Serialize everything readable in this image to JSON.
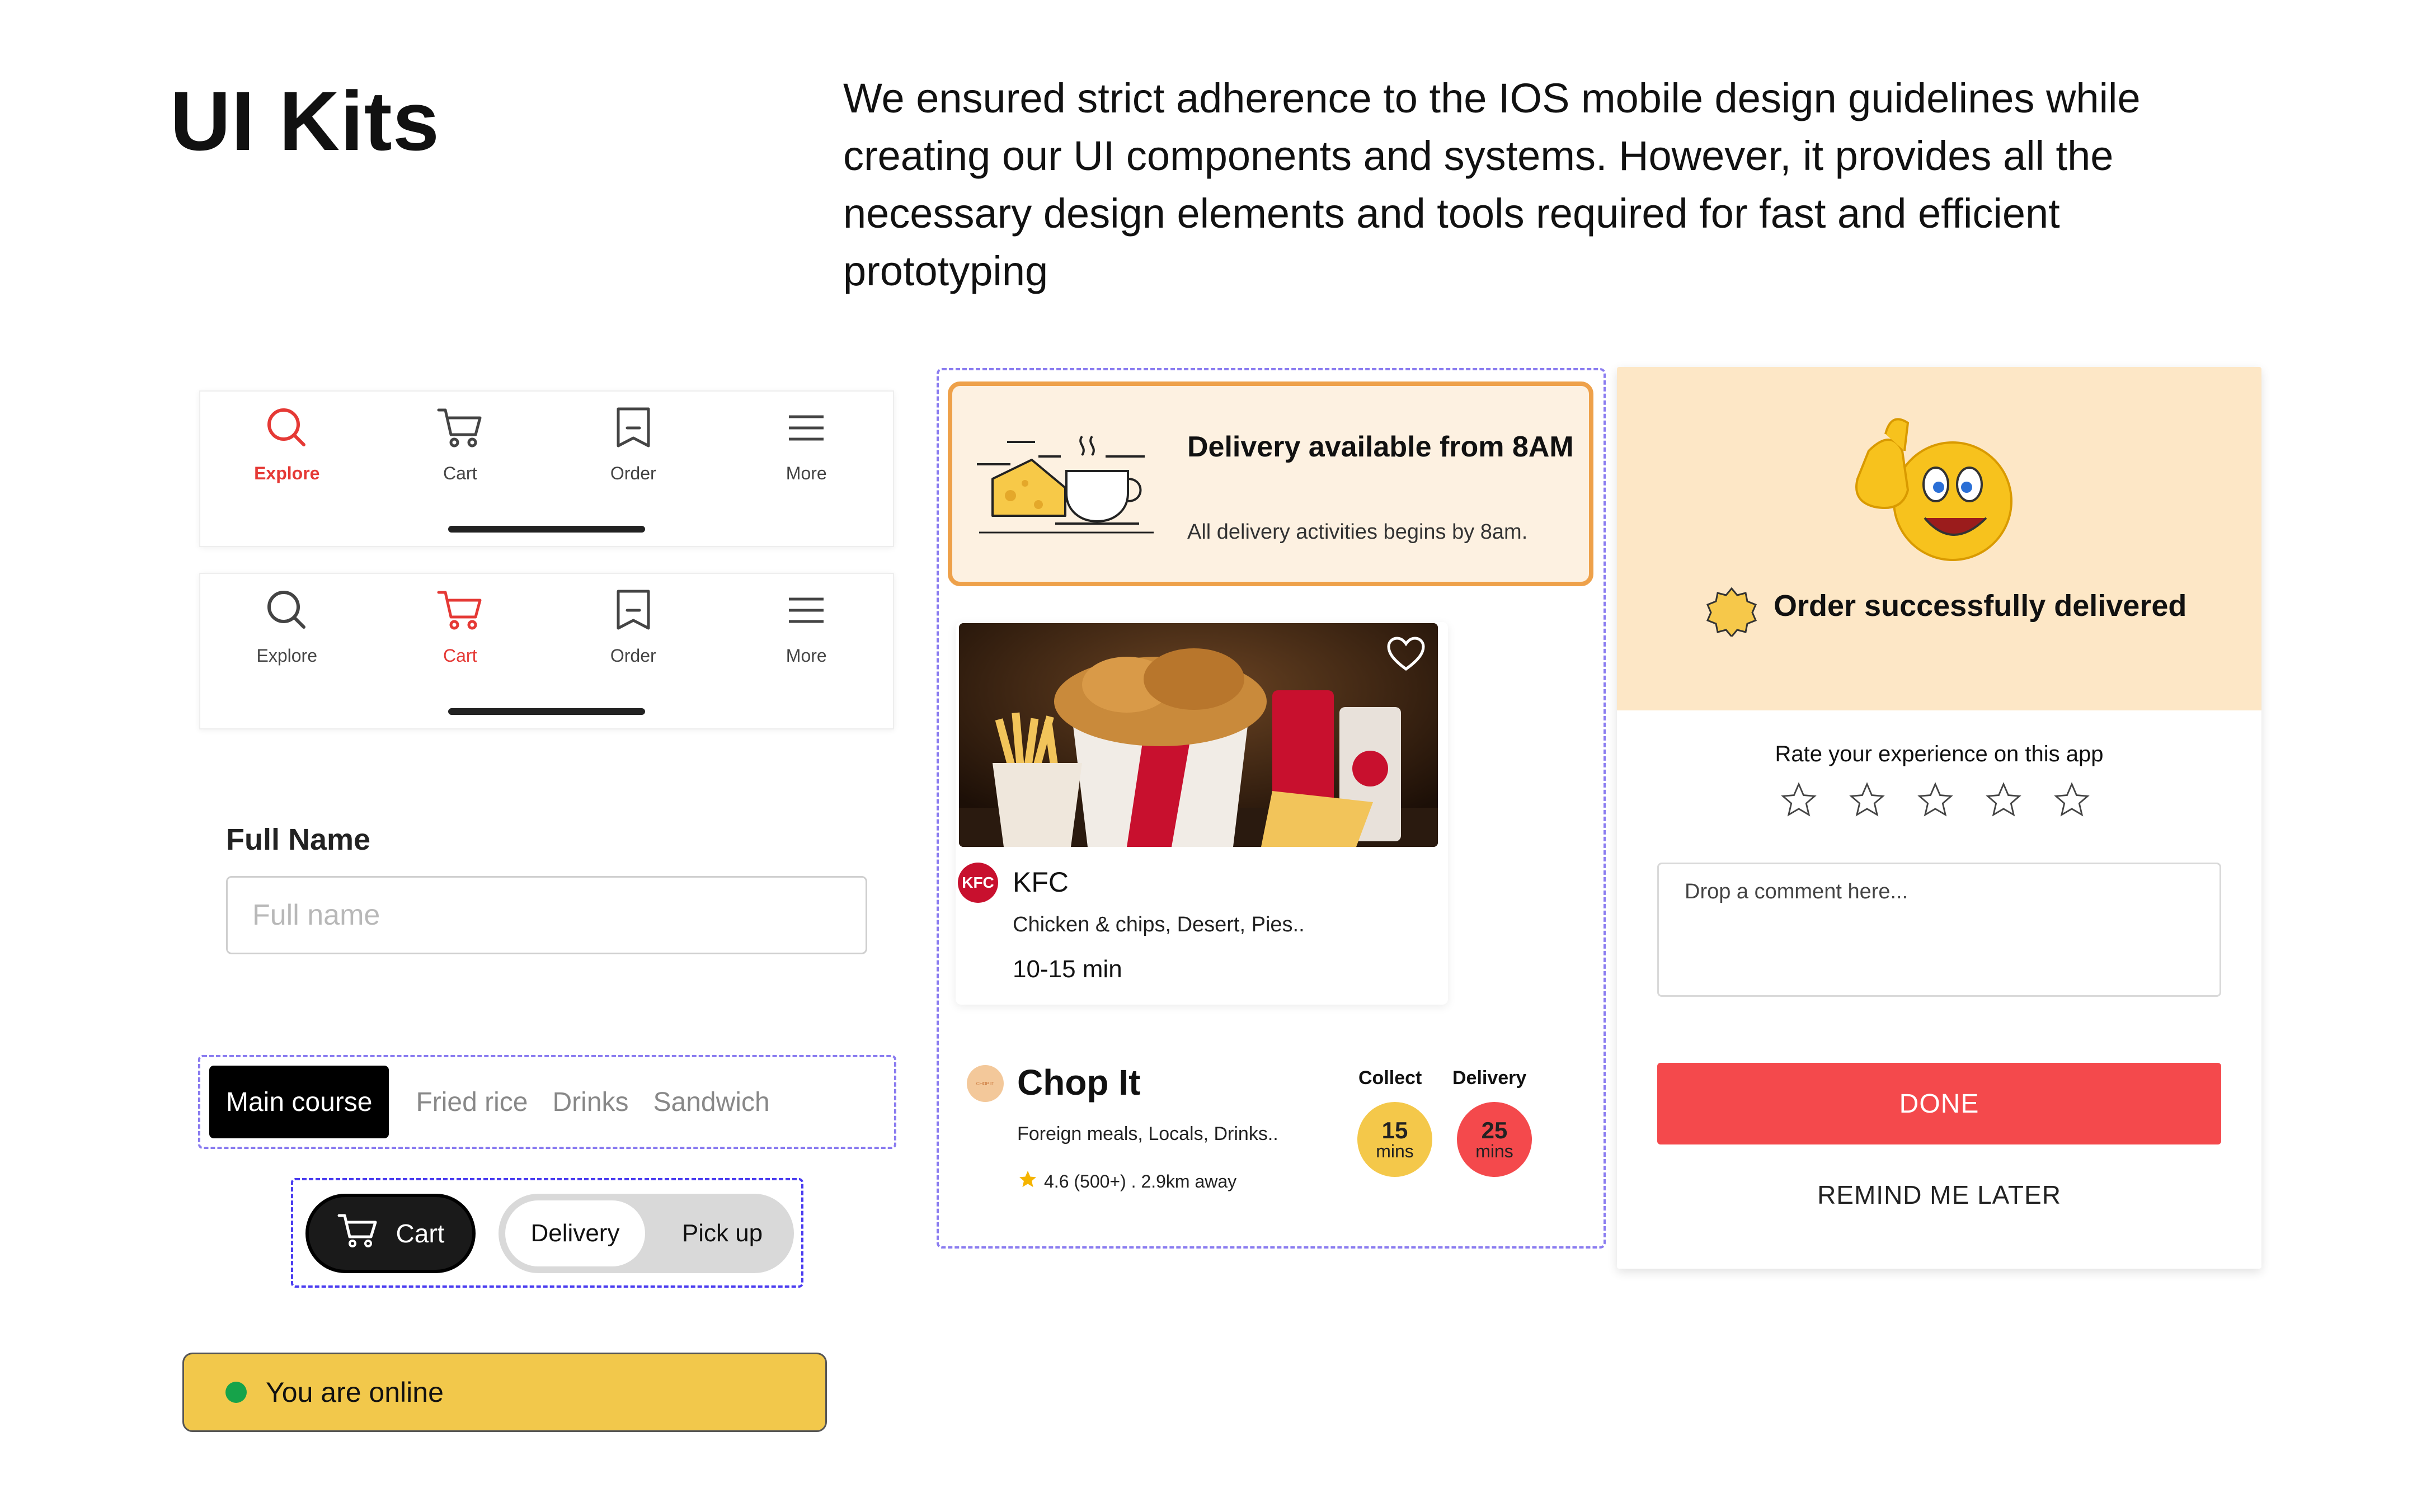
{
  "heading": {
    "title": "UI Kits",
    "description": "We ensured strict adherence to the IOS mobile design guidelines while creating our UI components and systems. However, it provides all the necessary design elements and tools required for fast and efficient prototyping"
  },
  "tabbar_1": {
    "items": [
      {
        "label": "Explore",
        "icon": "search-icon",
        "active": true
      },
      {
        "label": "Cart",
        "icon": "cart-icon",
        "active": false
      },
      {
        "label": "Order",
        "icon": "order-icon",
        "active": false
      },
      {
        "label": "More",
        "icon": "menu-icon",
        "active": false
      }
    ]
  },
  "tabbar_2": {
    "items": [
      {
        "label": "Explore",
        "icon": "search-icon",
        "active": false
      },
      {
        "label": "Cart",
        "icon": "cart-icon",
        "active": true
      },
      {
        "label": "Order",
        "icon": "order-icon",
        "active": false
      },
      {
        "label": "More",
        "icon": "menu-icon",
        "active": false
      }
    ]
  },
  "full_name": {
    "label": "Full Name",
    "placeholder": "Full name",
    "value": ""
  },
  "categories": {
    "items": [
      "Main course",
      "Fried rice",
      "Drinks",
      "Sandwich"
    ],
    "selected": "Main course"
  },
  "cart_toggle": {
    "cart_label": "Cart",
    "options": [
      "Delivery",
      "Pick up"
    ],
    "selected": "Delivery"
  },
  "online_banner": {
    "text": "You are online",
    "status_color": "#16a34a"
  },
  "delivery_notice": {
    "title": "Delivery available from 8AM",
    "subtitle": "All delivery activities begins by 8am."
  },
  "restaurant_card": {
    "logo_text": "KFC",
    "name": "KFC",
    "tags": "Chicken & chips, Desert, Pies..",
    "time": "10-15 min",
    "favorite": false
  },
  "chop_it": {
    "name": "Chop It",
    "logo_text": "CHOP IT",
    "tags": "Foreign meals, Locals, Drinks..",
    "rating": "4.6 (500+) . 2.9km away",
    "collect": {
      "label": "Collect",
      "value": "15",
      "unit": "mins",
      "color": "#f4c84a"
    },
    "delivery": {
      "label": "Delivery",
      "value": "25",
      "unit": "mins",
      "color": "#f4494c"
    }
  },
  "rating_card": {
    "title": "Order successfully delivered",
    "question": "Rate your experience on this app",
    "stars_total": 5,
    "stars_selected": 0,
    "comment_placeholder": "Drop a comment here...",
    "done_label": "DONE",
    "later_label": "REMIND ME LATER",
    "accent": "#f4494c",
    "banner_color": "#fde7c6"
  }
}
